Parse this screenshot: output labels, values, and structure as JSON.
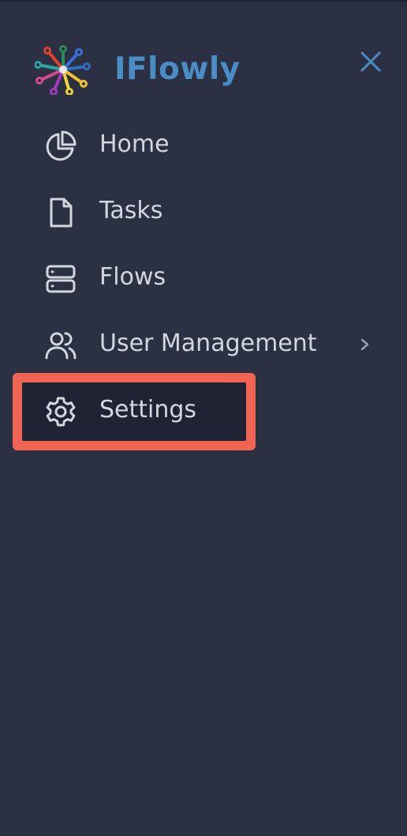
{
  "brand": {
    "name": "IFlowly",
    "color": "#4a8dc4"
  },
  "header": {
    "close_icon": "close-icon"
  },
  "nav": {
    "items": [
      {
        "label": "Home",
        "icon": "pie-chart-icon"
      },
      {
        "label": "Tasks",
        "icon": "document-icon"
      },
      {
        "label": "Flows",
        "icon": "server-icon"
      },
      {
        "label": "User Management",
        "icon": "users-icon",
        "has_submenu": true
      },
      {
        "label": "Settings",
        "icon": "gear-icon",
        "highlighted": true
      }
    ]
  },
  "colors": {
    "background": "#2b3042",
    "text": "#d3d6de",
    "highlight": "#ef6452",
    "highlight_fill": "#1f2333"
  }
}
